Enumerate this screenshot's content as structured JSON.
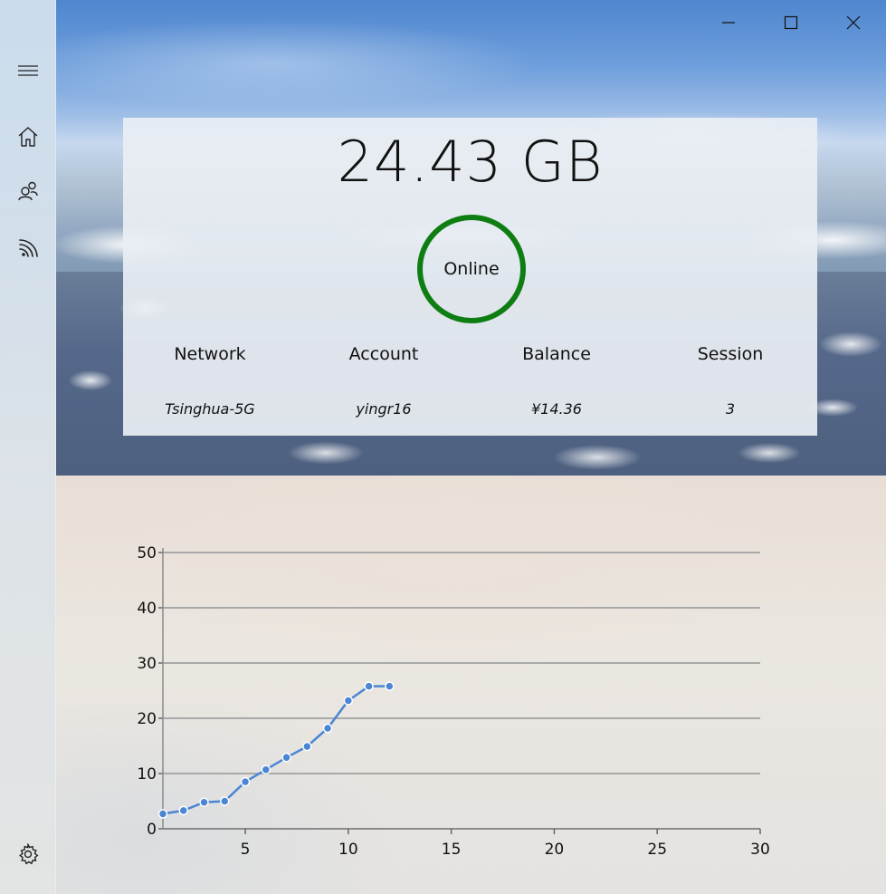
{
  "icons": {
    "menu": "hamburger-icon",
    "home": "home-icon",
    "accounts": "people-icon",
    "wifi": "wireless-icon",
    "settings": "gear-icon",
    "minimize": "minimize-icon",
    "maximize": "maximize-icon",
    "close": "close-icon"
  },
  "summary": {
    "usage": "24.43 GB",
    "status": "Online",
    "status_color": "#0e7d12"
  },
  "info": {
    "headers": [
      "Network",
      "Account",
      "Balance",
      "Session"
    ],
    "values": [
      "Tsinghua-5G",
      "yingr16",
      "¥14.36",
      "3"
    ]
  },
  "chart_data": {
    "type": "line",
    "x": [
      1,
      2,
      3,
      4,
      5,
      6,
      7,
      8,
      9,
      10,
      11,
      12
    ],
    "series": [
      {
        "values": [
          2.7,
          3.3,
          4.8,
          5.0,
          8.5,
          10.7,
          12.9,
          14.9,
          18.2,
          23.2,
          25.8,
          25.8
        ]
      }
    ],
    "xlim": [
      1,
      30
    ],
    "ylim": [
      0,
      50
    ],
    "xticks": [
      "5",
      "10",
      "15",
      "20",
      "25",
      "30"
    ],
    "yticks": [
      "0",
      "10",
      "20",
      "30",
      "40",
      "50"
    ],
    "grid": true,
    "line_color": "#4a86d4",
    "xlabel": "",
    "ylabel": ""
  }
}
